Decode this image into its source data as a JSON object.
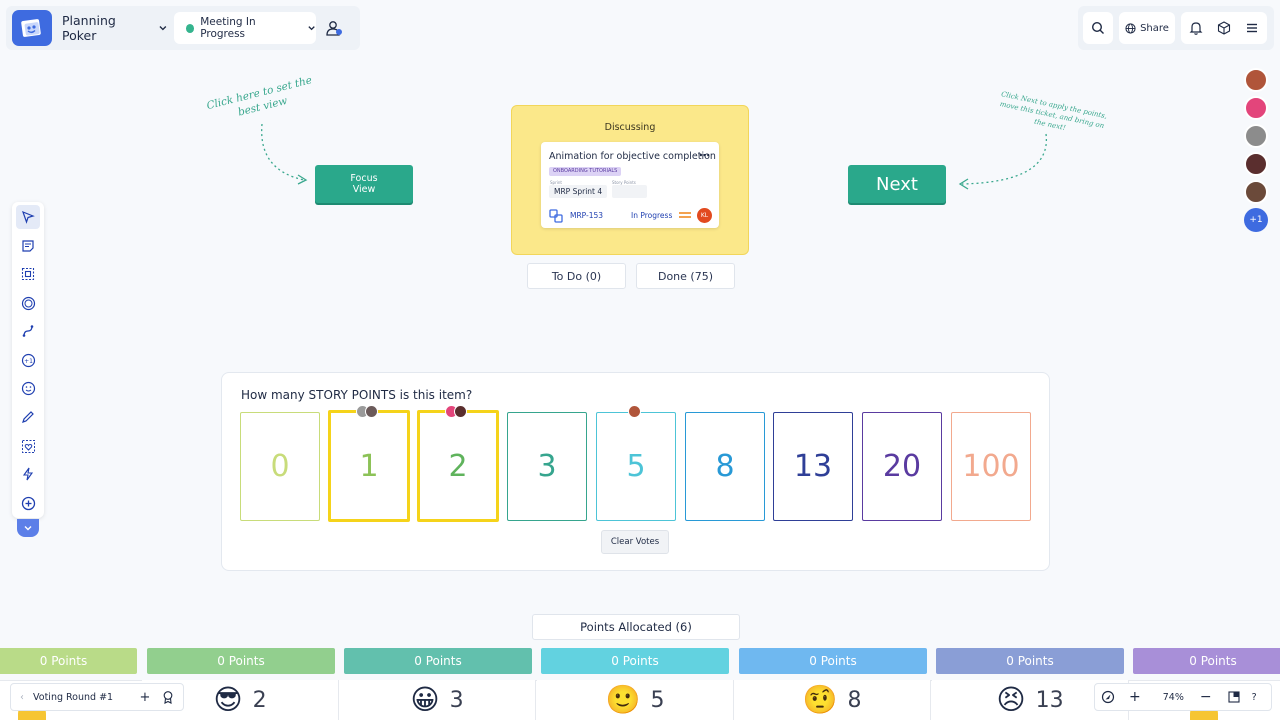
{
  "header": {
    "board_name": "Planning Poker",
    "meeting_status": "Meeting In Progress",
    "share_label": "Share"
  },
  "annotations": {
    "focus_hint": "Click here to set the best view",
    "next_hint": "Click Next to apply the points, move this ticket, and bring on the next!"
  },
  "buttons": {
    "focus_view": "Focus View",
    "next": "Next",
    "clear_votes": "Clear Votes"
  },
  "discussing": {
    "label": "Discussing",
    "ticket": {
      "title": "Animation for objective completion",
      "tag": "ONBOARDING TUTORIALS",
      "sprint_label": "Sprint",
      "sprint_value": "MRP Sprint 4",
      "story_points_label": "Story Points",
      "key": "MRP-153",
      "status": "In Progress",
      "assignee_initials": "KL"
    }
  },
  "tabs": {
    "todo": "To Do (0)",
    "done": "Done (75)"
  },
  "voting": {
    "question": "How many STORY POINTS is this item?",
    "cards": [
      {
        "value": "0",
        "color": "#c8dc7a"
      },
      {
        "value": "1",
        "color": "#8cc257"
      },
      {
        "value": "2",
        "color": "#5fb35c"
      },
      {
        "value": "3",
        "color": "#36a58e"
      },
      {
        "value": "5",
        "color": "#4dc4d7"
      },
      {
        "value": "8",
        "color": "#2899d6"
      },
      {
        "value": "13",
        "color": "#2f3f97"
      },
      {
        "value": "20",
        "color": "#5a3ba0"
      },
      {
        "value": "100",
        "color": "#f2a98e"
      }
    ],
    "chosen_border": "#f5d31a"
  },
  "points_allocated": "Points Allocated (6)",
  "point_bars": [
    {
      "label": "0 Points",
      "color": "#b9db88"
    },
    {
      "label": "0 Points",
      "color": "#92cf8e"
    },
    {
      "label": "0 Points",
      "color": "#62c0ad"
    },
    {
      "label": "0 Points",
      "color": "#62d2e0"
    },
    {
      "label": "0 Points",
      "color": "#6fb8f0"
    },
    {
      "label": "0 Points",
      "color": "#8a9ed6"
    },
    {
      "label": "0 Points",
      "color": "#a88fd8"
    }
  ],
  "bottom_values": [
    {
      "emoji": "😎",
      "value": "2"
    },
    {
      "emoji": "😀",
      "value": "3"
    },
    {
      "emoji": "🙂",
      "value": "5"
    },
    {
      "emoji": "🤨",
      "value": "8"
    },
    {
      "emoji": "😣",
      "value": "13"
    }
  ],
  "footer": {
    "voting_round": "Voting Round #1",
    "zoom": "74%",
    "help": "?"
  },
  "avatars": {
    "extra_count": "+1"
  }
}
